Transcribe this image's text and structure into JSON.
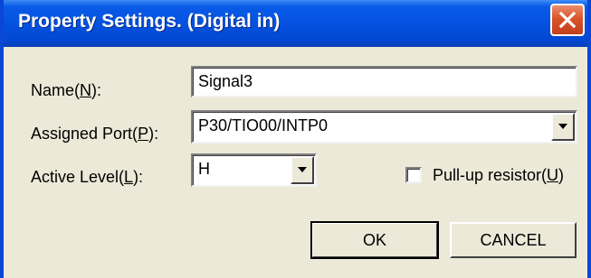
{
  "window": {
    "title": "Property Settings. (Digital in)",
    "close_icon": "close-x-icon"
  },
  "form": {
    "name": {
      "label_before": "Name(",
      "mnemonic": "N",
      "label_after": "):",
      "value": "Signal3"
    },
    "assigned_port": {
      "label_before": "Assigned Port(",
      "mnemonic": "P",
      "label_after": "):",
      "value": "P30/TIO00/INTP0",
      "dropdown_icon": "chevron-down-icon"
    },
    "active_level": {
      "label_before": "Active Level(",
      "mnemonic": "L",
      "label_after": "):",
      "value": "H",
      "dropdown_icon": "chevron-down-icon"
    },
    "pullup": {
      "label_before": "Pull-up resistor(",
      "mnemonic": "U",
      "label_after": ")",
      "checked": false
    }
  },
  "buttons": {
    "ok": "OK",
    "cancel": "CANCEL"
  },
  "colors": {
    "title_bar": "#0452e0",
    "close_button": "#d8542a",
    "dialog_face": "#ece9d8"
  }
}
